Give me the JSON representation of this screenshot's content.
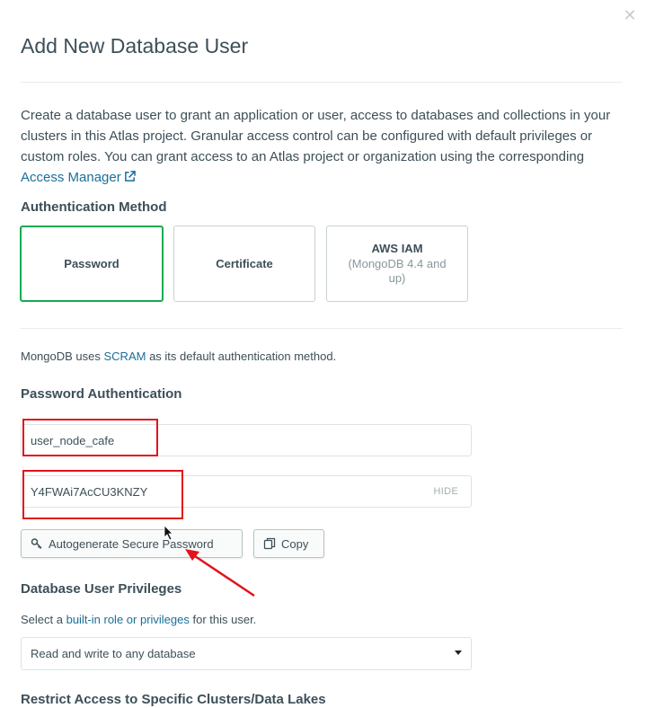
{
  "dialog": {
    "title": "Add New Database User",
    "intro_text": "Create a database user to grant an application or user, access to databases and collections in your clusters in this Atlas project. Granular access control can be configured with default privileges or custom roles. You can grant access to an Atlas project or organization using the corresponding ",
    "intro_link": "Access Manager"
  },
  "auth": {
    "heading": "Authentication Method",
    "options": [
      {
        "label": "Password",
        "selected": true
      },
      {
        "label": "Certificate",
        "selected": false
      },
      {
        "label": "AWS IAM",
        "sublabel": "(MongoDB 4.4 and up)",
        "selected": false
      }
    ],
    "scram_prefix": "MongoDB uses ",
    "scram_link": "SCRAM",
    "scram_suffix": " as its default authentication method."
  },
  "password_auth": {
    "heading": "Password Authentication",
    "username_value": "user_node_cafe",
    "password_value": "Y4FWAi7AcCU3KNZY",
    "hide_label": "HIDE",
    "autogenerate_label": "Autogenerate Secure Password",
    "copy_label": "Copy"
  },
  "privileges": {
    "heading": "Database User Privileges",
    "desc_prefix": "Select a ",
    "desc_link": "built-in role or privileges",
    "desc_suffix": " for this user.",
    "selected_role": "Read and write to any database"
  },
  "restrict": {
    "heading": "Restrict Access to Specific Clusters/Data Lakes"
  },
  "colors": {
    "accent_green": "#13aa52",
    "link_blue": "#1a6f99",
    "annotation_red": "#e3121b"
  }
}
